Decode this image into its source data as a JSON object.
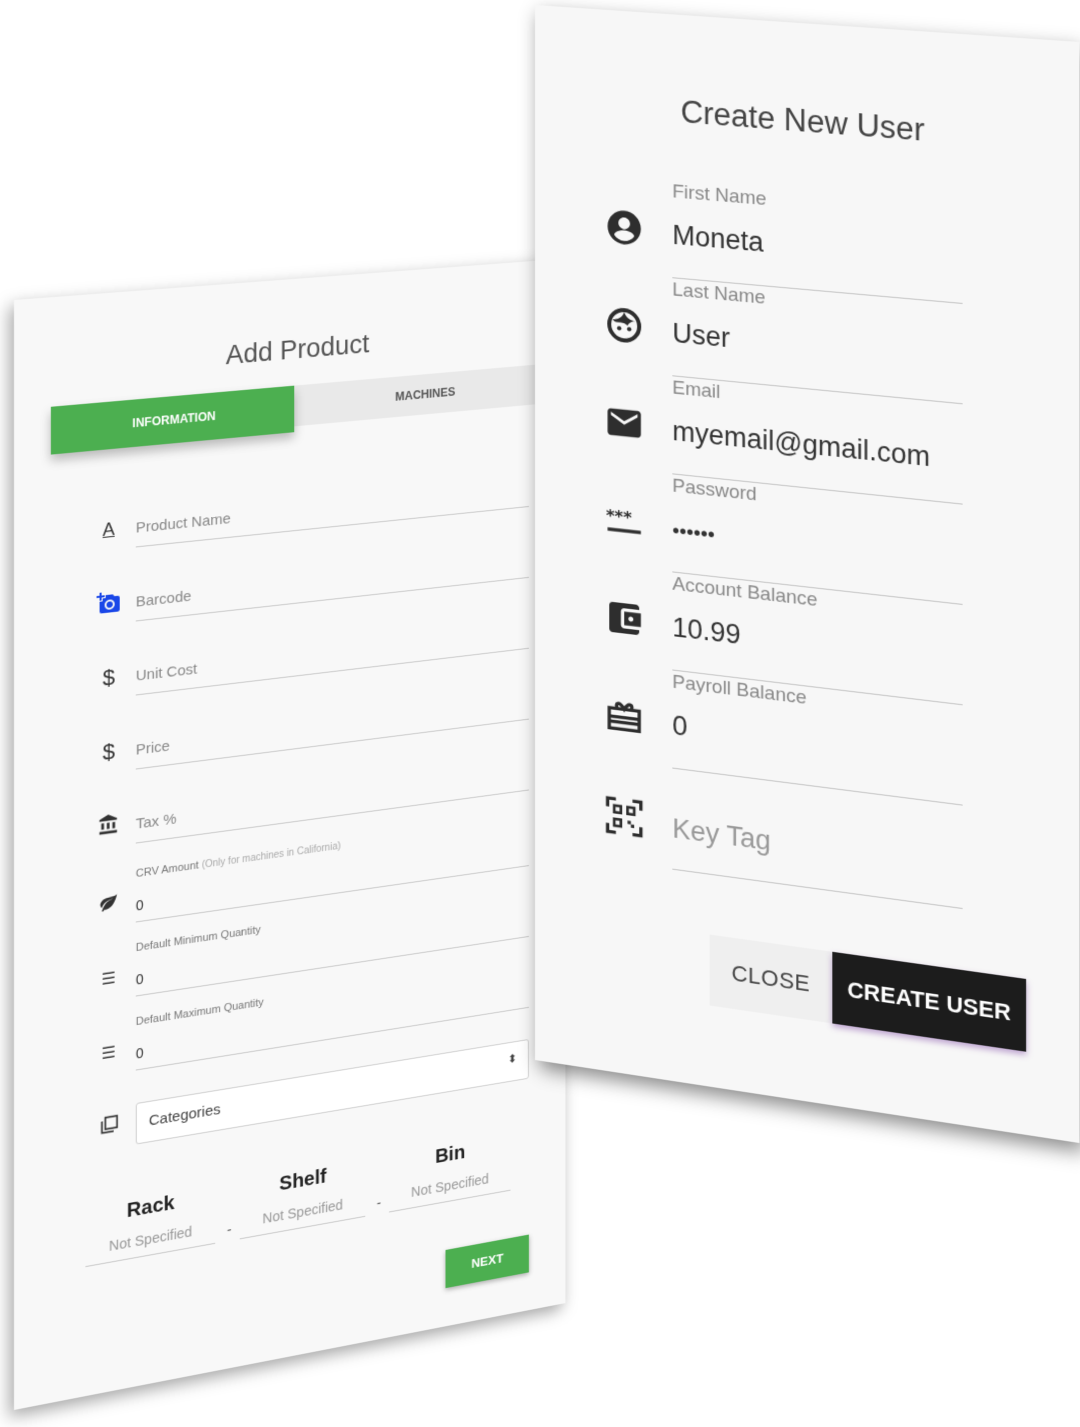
{
  "add_product": {
    "title": "Add Product",
    "tabs": [
      {
        "label": "INFORMATION",
        "active": true
      },
      {
        "label": "MACHINES",
        "active": false
      }
    ],
    "fields": {
      "product_name": {
        "placeholder": "Product Name",
        "icon": "text-format-icon"
      },
      "barcode": {
        "placeholder": "Barcode",
        "icon": "add-photo-icon"
      },
      "unit_cost": {
        "placeholder": "Unit Cost",
        "icon": "dollar-icon"
      },
      "price": {
        "placeholder": "Price",
        "icon": "dollar-icon"
      },
      "tax": {
        "placeholder": "Tax %",
        "icon": "bank-icon"
      },
      "crv_amount": {
        "label": "CRV Amount",
        "note": "(Only for machines in California)",
        "value": "0",
        "icon": "leaf-icon"
      },
      "default_min_qty": {
        "label": "Default Minimum Quantity",
        "value": "0",
        "icon": "sort-numeric-icon"
      },
      "default_max_qty": {
        "label": "Default Maximum Quantity",
        "value": "0",
        "icon": "sort-numeric-icon"
      },
      "categories": {
        "value": "Categories",
        "icon": "library-icon"
      }
    },
    "location": {
      "rack": {
        "label": "Rack",
        "value": "Not Specified"
      },
      "shelf": {
        "label": "Shelf",
        "value": "Not Specified"
      },
      "bin": {
        "label": "Bin",
        "value": "Not Specified"
      },
      "separator": "-"
    },
    "next_label": "NEXT",
    "accent": "#4caf50"
  },
  "create_user": {
    "title": "Create New User",
    "fields": [
      {
        "label": "First Name",
        "value": "Moneta",
        "icon": "account-circle-icon"
      },
      {
        "label": "Last Name",
        "value": "User",
        "icon": "face-icon"
      },
      {
        "label": "Email",
        "value": "myemail@gmail.com",
        "icon": "mail-icon"
      },
      {
        "label": "Password",
        "value": "••••••",
        "icon": "password-icon"
      },
      {
        "label": "Account Balance",
        "value": "10.99",
        "icon": "wallet-icon"
      },
      {
        "label": "Payroll Balance",
        "value": "0",
        "icon": "giftcard-icon"
      }
    ],
    "key_tag": {
      "placeholder": "Key Tag",
      "icon": "qr-code-icon"
    },
    "close_label": "CLOSE",
    "create_label": "CREATE USER",
    "button_color": "#1c1c1c"
  }
}
